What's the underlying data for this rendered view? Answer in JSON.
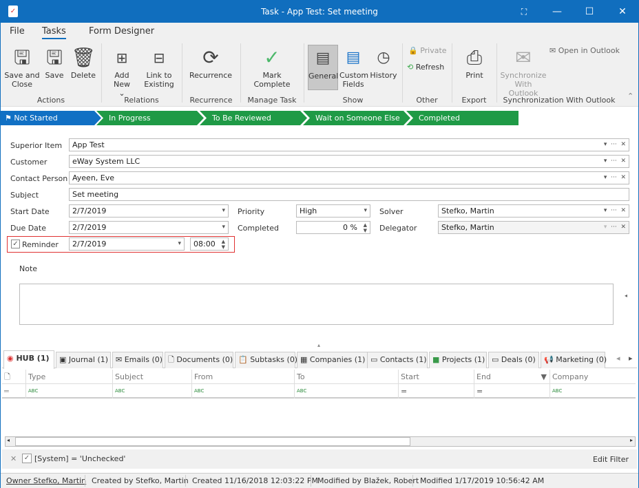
{
  "window": {
    "title": "Task - App Test: Set meeting",
    "icon": "clipboard-check-icon"
  },
  "ribbon_tabs": [
    "File",
    "Tasks",
    "Form Designer"
  ],
  "ribbon": {
    "buttons": {
      "save_close": "Save and Close",
      "save": "Save",
      "delete": "Delete",
      "add_new": "Add New",
      "link_existing": "Link to Existing",
      "recurrence": "Recurrence",
      "mark_complete": "Mark Complete",
      "general": "General",
      "custom_fields": "Custom Fields",
      "history": "History",
      "private": "Private",
      "refresh": "Refresh",
      "print": "Print",
      "synchronize": "Synchronize With Outlook",
      "open_outlook": "Open in Outlook"
    },
    "groups": [
      "Actions",
      "Relations",
      "Recurrence",
      "Manage Task",
      "Show",
      "Other",
      "Export",
      "Synchronization With Outlook"
    ]
  },
  "stages": [
    {
      "label": "Not Started",
      "color": "#1170c4"
    },
    {
      "label": "In Progress",
      "color": "#1f9a46"
    },
    {
      "label": "To Be Reviewed",
      "color": "#1f9a46"
    },
    {
      "label": "Wait on Someone Else",
      "color": "#1f9a46"
    },
    {
      "label": "Completed",
      "color": "#1f9a46"
    }
  ],
  "form": {
    "superior_item": {
      "label": "Superior Item",
      "value": "App Test"
    },
    "customer": {
      "label": "Customer",
      "value": "eWay System LLC"
    },
    "contact_person": {
      "label": "Contact Person",
      "value": "Ayeen, Eve"
    },
    "subject": {
      "label": "Subject",
      "value": "Set meeting"
    },
    "start_date": {
      "label": "Start Date",
      "value": "2/7/2019"
    },
    "due_date": {
      "label": "Due Date",
      "value": "2/7/2019"
    },
    "priority": {
      "label": "Priority",
      "value": "High"
    },
    "completed": {
      "label": "Completed",
      "value": "0 %"
    },
    "solver": {
      "label": "Solver",
      "value": "Stefko, Martin"
    },
    "delegator": {
      "label": "Delegator",
      "value": "Stefko, Martin"
    },
    "reminder": {
      "label": "Reminder",
      "checked": true,
      "date": "2/7/2019",
      "time": "08:00"
    },
    "note": {
      "label": "Note",
      "value": ""
    }
  },
  "tabs": [
    "HUB (1)",
    "Journal (1)",
    "Emails (0)",
    "Documents (0)",
    "Subtasks (0)",
    "Companies (1)",
    "Contacts (1)",
    "Projects (1)",
    "Deals (0)",
    "Marketing (0)"
  ],
  "grid": {
    "columns": [
      "Type",
      "Subject",
      "From",
      "To",
      "Start",
      "End",
      "Company"
    ],
    "filter_row": [
      "ABC",
      "ABC",
      "ABC",
      "ABC",
      "=",
      "=",
      "ABC"
    ]
  },
  "filter": {
    "text": "[System] = 'Unchecked'",
    "edit": "Edit Filter"
  },
  "status": {
    "owner": "Owner Stefko, Martin",
    "created_by": "Created by Stefko, Martin",
    "created": "Created 11/16/2018 12:03:22 PM",
    "modified_by": "Modified by Blažek, Robert",
    "modified": "Modified 1/17/2019 10:56:42 AM"
  }
}
